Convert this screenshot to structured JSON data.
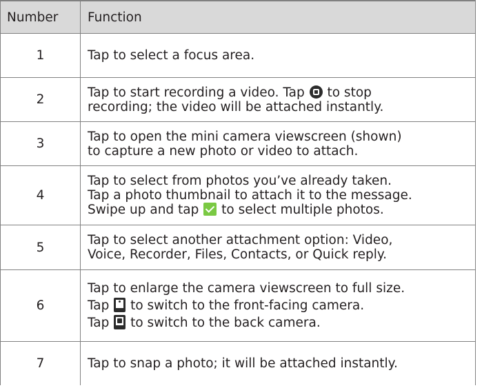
{
  "table": {
    "header": {
      "number": "Number",
      "function": "Function"
    },
    "rows": [
      {
        "number": "1",
        "lines": [
          {
            "pre": "Tap to select a focus area."
          }
        ]
      },
      {
        "number": "2",
        "lines": [
          {
            "pre": "Tap to start recording a video. Tap ",
            "icon": "stop-record-icon",
            "post": " to stop"
          },
          {
            "pre": "recording; the video will be attached instantly."
          }
        ]
      },
      {
        "number": "3",
        "lines": [
          {
            "pre": "Tap to open the mini camera viewscreen (shown)"
          },
          {
            "pre": "to capture a new photo or video to attach."
          }
        ]
      },
      {
        "number": "4",
        "lines": [
          {
            "pre": "Tap to select from photos you’ve already taken."
          },
          {
            "pre": "Tap a photo thumbnail to attach it to the message."
          },
          {
            "pre": "Swipe up and tap ",
            "icon": "checkbox-icon",
            "post": " to select multiple photos."
          }
        ]
      },
      {
        "number": "5",
        "lines": [
          {
            "pre": "Tap to select another attachment option: Video,"
          },
          {
            "pre": "Voice, Recorder, Files, Contacts, or Quick reply."
          }
        ]
      },
      {
        "number": "6",
        "lines": [
          {
            "pre": "Tap to enlarge the camera viewscreen to full size."
          },
          {
            "pre": "Tap ",
            "icon": "front-camera-icon",
            "post": " to switch to the front-facing camera."
          },
          {
            "pre": "Tap ",
            "icon": "back-camera-icon",
            "post": " to switch to the back camera."
          }
        ]
      },
      {
        "number": "7",
        "lines": [
          {
            "pre": "Tap to snap a photo; it will be attached instantly."
          }
        ]
      }
    ]
  }
}
